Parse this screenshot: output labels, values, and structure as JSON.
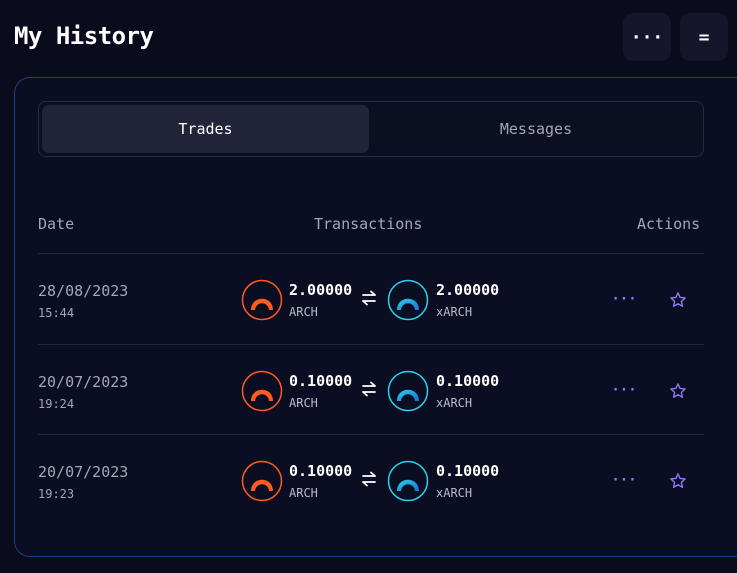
{
  "header": {
    "title": "My History",
    "more_label": "···",
    "menu_label": "="
  },
  "tabs": [
    {
      "label": "Trades",
      "active": true
    },
    {
      "label": "Messages",
      "active": false
    }
  ],
  "columns": {
    "date": "Date",
    "transactions": "Transactions",
    "actions": "Actions"
  },
  "rows": [
    {
      "date": "28/08/2023",
      "time": "15:44",
      "from_amount": "2.00000",
      "from_symbol": "ARCH",
      "to_amount": "2.00000",
      "to_symbol": "xARCH",
      "more_label": "···"
    },
    {
      "date": "20/07/2023",
      "time": "19:24",
      "from_amount": "0.10000",
      "from_symbol": "ARCH",
      "to_amount": "0.10000",
      "to_symbol": "xARCH",
      "more_label": "···"
    },
    {
      "date": "20/07/2023",
      "time": "19:23",
      "from_amount": "0.10000",
      "from_symbol": "ARCH",
      "to_amount": "0.10000",
      "to_symbol": "xARCH",
      "more_label": "···"
    }
  ],
  "colors": {
    "background": "#0a0b1c",
    "card_border": "#1d3f7a",
    "arch_orange": "#ff5a1f",
    "xarch_teal": "#2ad3e8",
    "action_purple": "#8c7bff"
  },
  "icons": {
    "arch": "arch-token-icon",
    "xarch": "xarch-token-icon",
    "swap": "swap-arrows-icon",
    "star": "star-icon",
    "more": "more-dots-icon",
    "menu": "menu-icon"
  }
}
